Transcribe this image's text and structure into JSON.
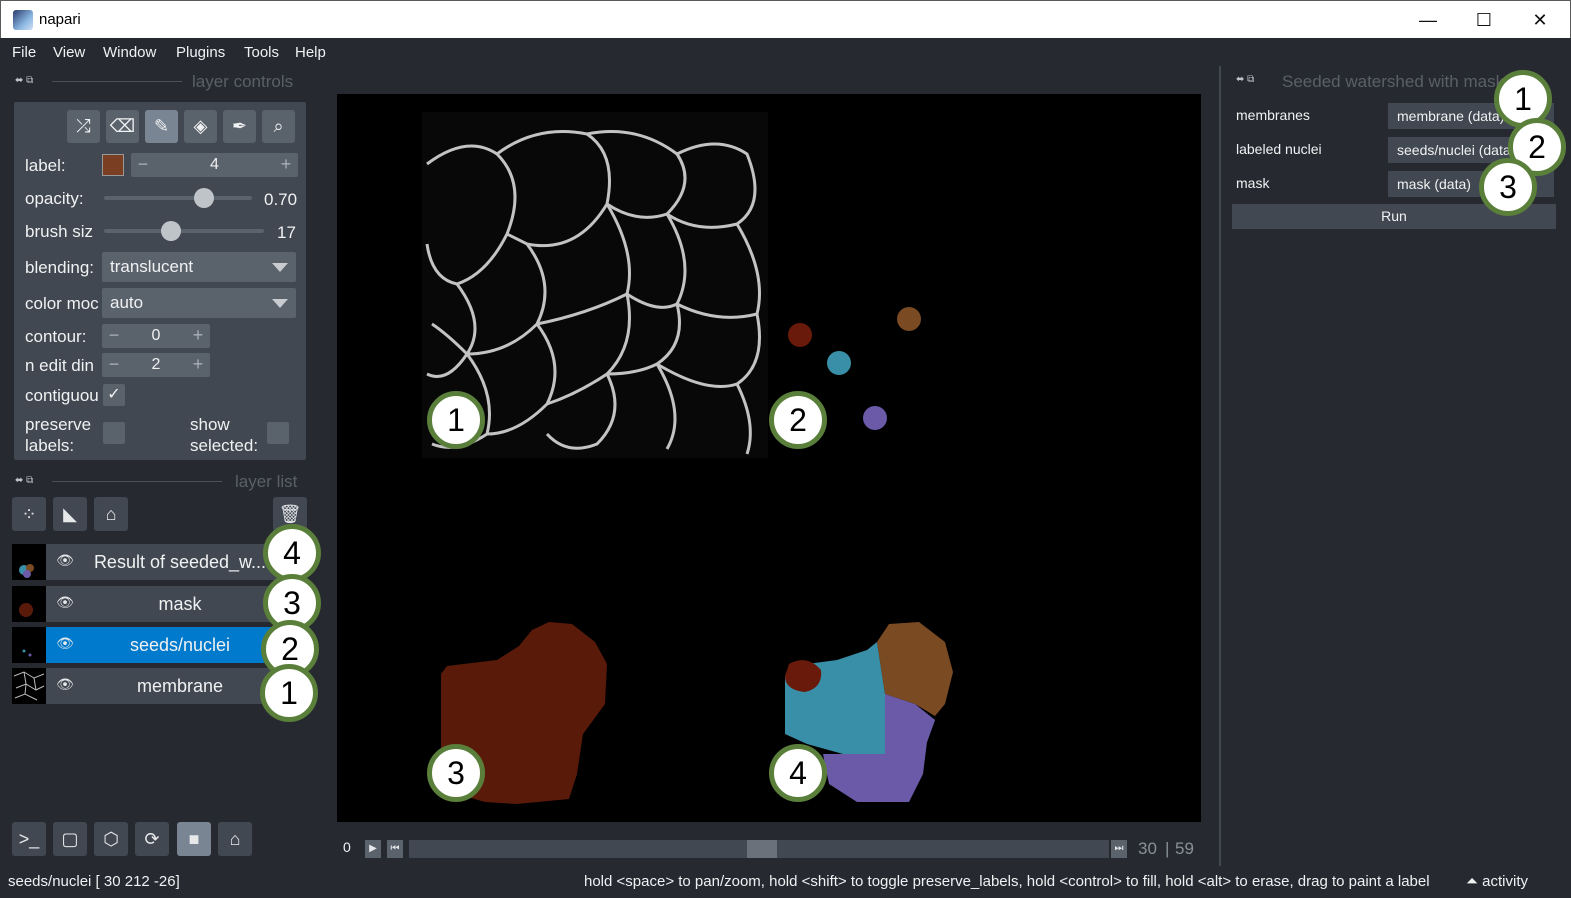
{
  "window": {
    "title": "napari",
    "minimize": "—",
    "maximize": "☐",
    "close": "✕"
  },
  "menu": [
    "File",
    "View",
    "Window",
    "Plugins",
    "Tools",
    "Help"
  ],
  "layer_controls": {
    "handle_title": "layer controls",
    "label_label": "label:",
    "label_value": "4",
    "opacity_label": "opacity:",
    "opacity_value": "0.70",
    "opacity_fraction": 0.7,
    "brush_label": "brush siz",
    "brush_value": "17",
    "blending_label": "blending:",
    "blending_value": "translucent",
    "colormode_label": "color moc",
    "colormode_value": "auto",
    "contour_label": "contour:",
    "contour_value": "0",
    "ndim_label": "n edit din",
    "ndim_value": "2",
    "contiguous_label": "contiguou",
    "preserve_label": "preserve\nlabels:",
    "show_selected_label": "show\nselected:",
    "swatch_color": "#7a3f22"
  },
  "layer_list": {
    "handle_title": "layer list",
    "layers": [
      {
        "name": "Result of seeded_w...",
        "selected": false
      },
      {
        "name": "mask",
        "selected": false
      },
      {
        "name": "seeds/nuclei",
        "selected": true
      },
      {
        "name": "membrane",
        "selected": false
      }
    ]
  },
  "badges": {
    "b1": "1",
    "b2": "2",
    "b3": "3",
    "b4": "4"
  },
  "dims": {
    "start": "0",
    "current": "30",
    "total": "59"
  },
  "plugin": {
    "title": "Seeded watershed with mask",
    "fields": [
      {
        "label": "membranes",
        "value": "membrane (data)"
      },
      {
        "label": "labeled nuclei",
        "value": "seeds/nuclei (data)"
      },
      {
        "label": "mask",
        "value": "mask (data)"
      }
    ],
    "run_label": "Run"
  },
  "status": {
    "left": "seeds/nuclei [ 30 212 -26]",
    "hint": "hold <space> to pan/zoom, hold <shift> to toggle preserve_labels, hold <control> to fill, hold <alt> to erase, drag to paint a label",
    "activity": "activity"
  },
  "colors": {
    "background": "#262930",
    "panel": "#414851",
    "selected": "#007acc",
    "badge_border": "#5a7f3a",
    "mask": "#5a1a0a",
    "label_cyan": "#3a8fa8",
    "label_brown": "#7a4a22",
    "label_purple": "#6a5aa8",
    "label_darkred": "#6a1a0a"
  },
  "icons": {
    "shuffle": "shuffle-icon",
    "erase": "eraser-icon",
    "paint": "brush-icon",
    "fill": "bucket-icon",
    "picker": "picker-icon",
    "zoom": "magnifier-icon",
    "eye": "eye-icon"
  }
}
